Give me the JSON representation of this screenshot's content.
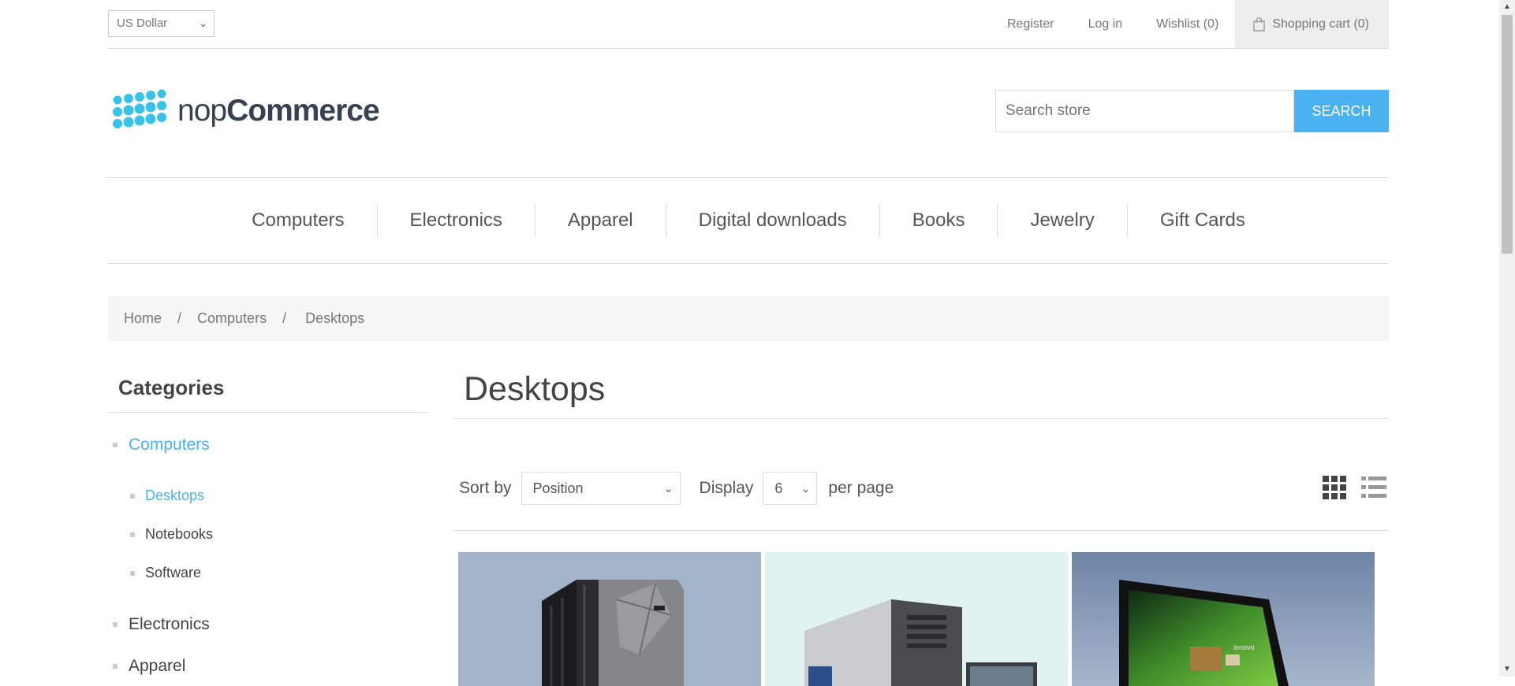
{
  "header": {
    "currency": "US Dollar",
    "links": [
      "Register",
      "Log in",
      "Wishlist (0)"
    ],
    "cart": "Shopping cart (0)"
  },
  "logo": {
    "text_light": "nop",
    "text_bold": "Commerce",
    "color": "#39c2e7"
  },
  "search": {
    "placeholder": "Search store",
    "button": "SEARCH"
  },
  "menu": [
    "Computers",
    "Electronics",
    "Apparel",
    "Digital downloads",
    "Books",
    "Jewelry",
    "Gift Cards"
  ],
  "breadcrumb": {
    "home": "Home",
    "sep": "/",
    "parent": "Computers",
    "current": "Desktops"
  },
  "categories": {
    "title": "Categories",
    "items": [
      {
        "label": "Computers",
        "level": 1,
        "active": true
      },
      {
        "label": "Desktops",
        "level": 2,
        "active": true
      },
      {
        "label": "Notebooks",
        "level": 2,
        "active": false
      },
      {
        "label": "Software",
        "level": 2,
        "active": false
      },
      {
        "label": "Electronics",
        "level": 1,
        "active": false
      },
      {
        "label": "Apparel",
        "level": 1,
        "active": false
      }
    ]
  },
  "main": {
    "title": "Desktops",
    "sort_label": "Sort by",
    "sort_value": "Position",
    "display_label": "Display",
    "display_value": "6",
    "per_page": "per page",
    "view_modes": [
      "grid-icon",
      "list-icon"
    ]
  },
  "products": [
    {
      "image": "server-tower-image",
      "bg": "#a2b4ca"
    },
    {
      "image": "desktop-pc-image",
      "bg": "#e0f2f1"
    },
    {
      "image": "lenovo-all-in-one-image",
      "bg": "#8499b5"
    }
  ],
  "colors": {
    "accent": "#4ab2f1",
    "text": "#444444",
    "muted": "#777777",
    "border": "#dddddd"
  }
}
